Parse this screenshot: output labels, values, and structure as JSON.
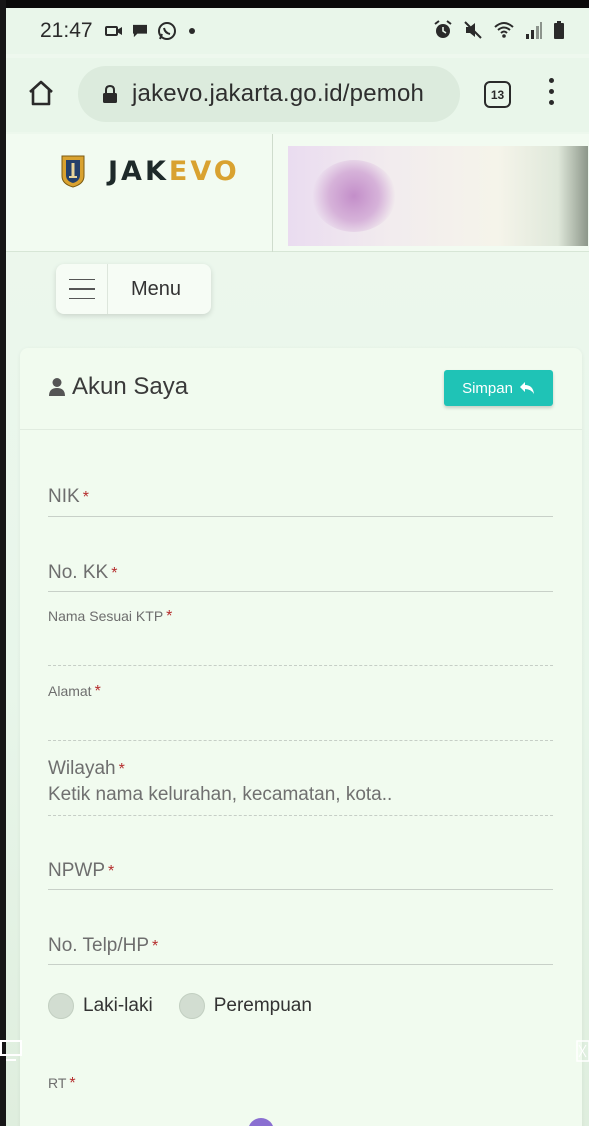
{
  "status_bar": {
    "time": "21:47",
    "left_icons": [
      "video-icon",
      "message-icon",
      "whatsapp-icon",
      "dot-icon"
    ],
    "right_icons": [
      "alarm-icon",
      "mute-icon",
      "wifi-icon",
      "signal-icon",
      "battery-icon"
    ]
  },
  "browser": {
    "url": "jakevo.jakarta.go.id/pemoh",
    "tab_count": "13"
  },
  "header": {
    "logo_prefix": "JAK",
    "logo_suffix": "EVO"
  },
  "menu": {
    "label": "Menu"
  },
  "card": {
    "title": "Akun Saya",
    "save_label": "Simpan"
  },
  "form": {
    "required_mark": "*",
    "nik_label": "NIK",
    "kk_label": "No. KK",
    "nama_label": "Nama Sesuai KTP",
    "alamat_label": "Alamat",
    "wilayah_label": "Wilayah",
    "wilayah_placeholder": "Ketik nama kelurahan, kecamatan, kota..",
    "npwp_label": "NPWP",
    "telp_label": "No. Telp/HP",
    "gender_options": [
      "Laki-laki",
      "Perempuan"
    ],
    "rt_label": "RT"
  },
  "colors": {
    "accent": "#1fc3b6",
    "required": "#b52d2d",
    "logo_suffix": "#d9a230"
  }
}
